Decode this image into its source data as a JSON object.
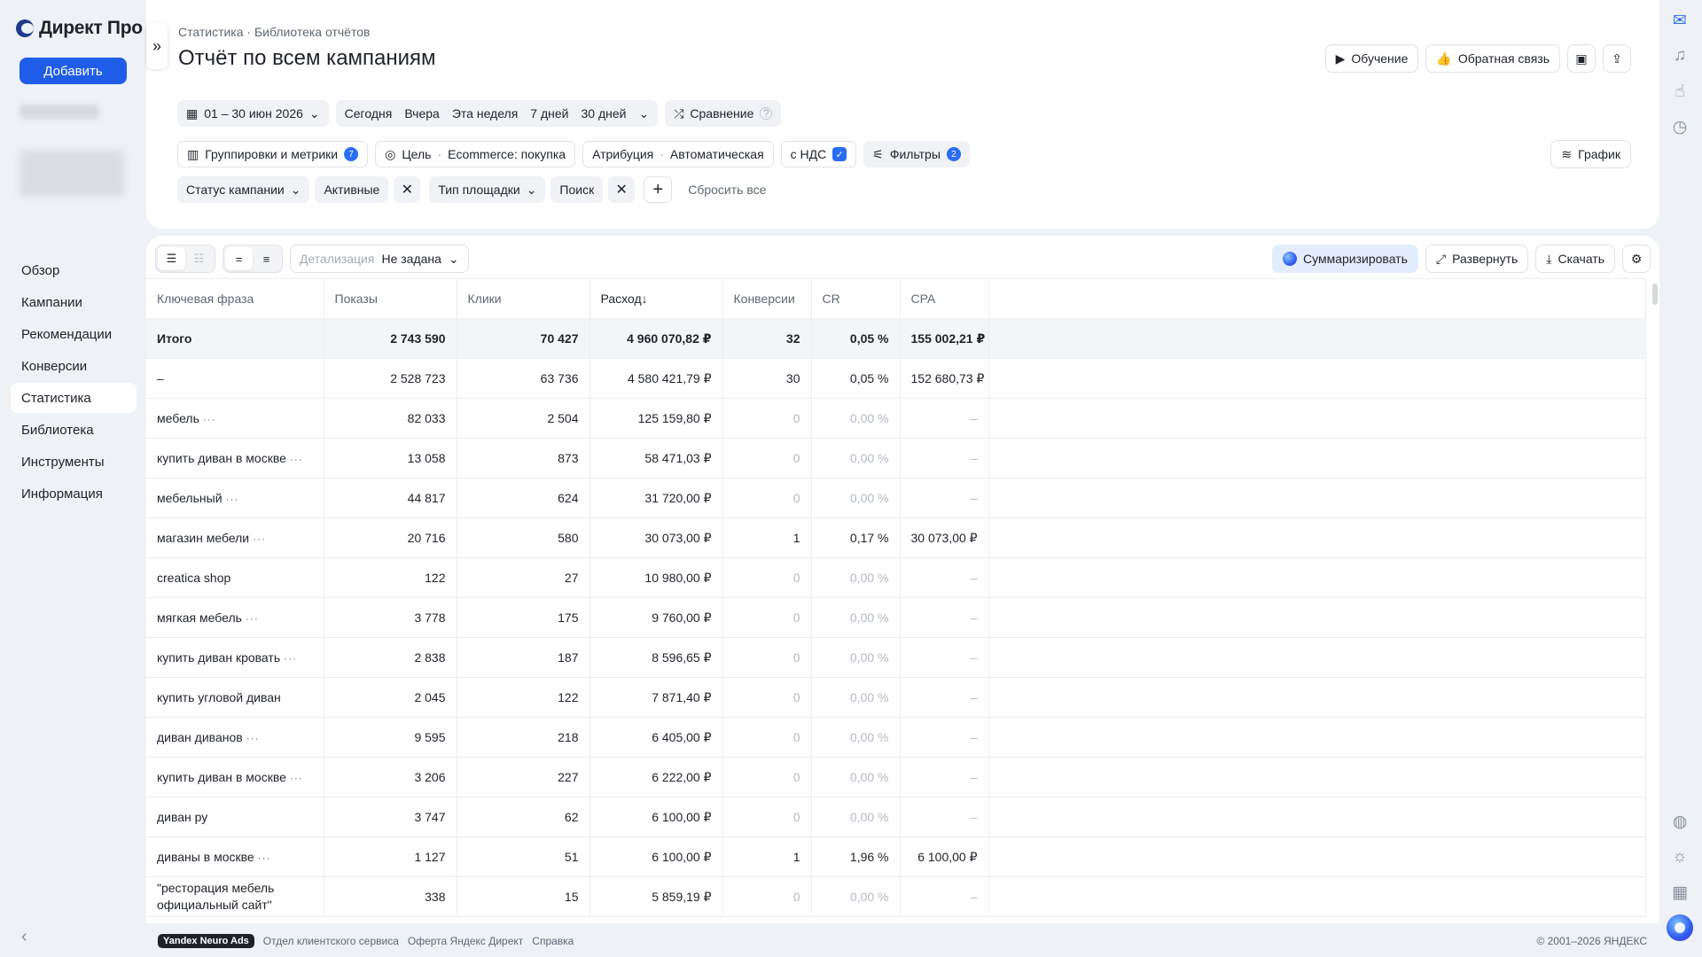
{
  "app": {
    "logo_text": "Директ Про",
    "add_label": "Добавить"
  },
  "nav": [
    "Обзор",
    "Кампании",
    "Рекомендации",
    "Конверсии",
    "Статистика",
    "Библиотека",
    "Инструменты",
    "Информация"
  ],
  "header": {
    "breadcrumb": "Статистика · Библиотека отчётов",
    "title": "Отчёт по всем кампаниям",
    "learn_label": "Обучение",
    "feedback_label": "Обратная связь"
  },
  "period": {
    "range": "01 – 30 июн 2026",
    "presets": [
      "Сегодня",
      "Вчера",
      "Эта неделя",
      "7 дней",
      "30 дней"
    ],
    "compare_label": "Сравнение"
  },
  "settings": {
    "groupings_label": "Группировки и метрики",
    "groupings_count": "7",
    "goal_label": "Цель",
    "goal_value": "Ecommerce: покупка",
    "attribution_label": "Атрибуция",
    "attribution_value": "Автоматическая",
    "vat_label": "с НДС",
    "filters_label": "Фильтры",
    "filters_count": "2",
    "graph_label": "График"
  },
  "filters": {
    "campaign_status_label": "Статус кампании",
    "campaign_status_value": "Активные",
    "placement_type_label": "Тип площадки",
    "placement_type_value": "Поиск",
    "reset_label": "Сбросить все"
  },
  "toolbar": {
    "detail_label": "Детализация",
    "detail_value": "Не задана",
    "summarize_label": "Суммаризировать",
    "expand_label": "Развернуть",
    "download_label": "Скачать"
  },
  "table": {
    "columns": [
      "Ключевая фраза",
      "Показы",
      "Клики",
      "Расход",
      "Конверсии",
      "CR",
      "CPA"
    ],
    "sort_indicator": "↓",
    "rows": [
      {
        "phrase": "Итого",
        "shows": "2 743 590",
        "clicks": "70 427",
        "cost": "4 960 070,82 ₽",
        "conv": "32",
        "cr": "0,05 %",
        "cpa": "155 002,21 ₽"
      },
      {
        "phrase": "–",
        "shows": "2 528 723",
        "clicks": "63 736",
        "cost": "4 580 421,79 ₽",
        "conv": "30",
        "cr": "0,05 %",
        "cpa": "152 680,73 ₽"
      },
      {
        "phrase": "мебель",
        "dots": true,
        "shows": "82 033",
        "clicks": "2 504",
        "cost": "125 159,80 ₽",
        "conv": "0",
        "cr": "0,00 %",
        "cpa": "–"
      },
      {
        "phrase": "купить диван в москве",
        "dots": true,
        "shows": "13 058",
        "clicks": "873",
        "cost": "58 471,03 ₽",
        "conv": "0",
        "cr": "0,00 %",
        "cpa": "–"
      },
      {
        "phrase": "мебельный",
        "dots": true,
        "shows": "44 817",
        "clicks": "624",
        "cost": "31 720,00 ₽",
        "conv": "0",
        "cr": "0,00 %",
        "cpa": "–"
      },
      {
        "phrase": "магазин мебели",
        "dots": true,
        "shows": "20 716",
        "clicks": "580",
        "cost": "30 073,00 ₽",
        "conv": "1",
        "cr": "0,17 %",
        "cpa": "30 073,00 ₽"
      },
      {
        "phrase": "creatica shop",
        "shows": "122",
        "clicks": "27",
        "cost": "10 980,00 ₽",
        "conv": "0",
        "cr": "0,00 %",
        "cpa": "–"
      },
      {
        "phrase": "мягкая мебель",
        "dots": true,
        "shows": "3 778",
        "clicks": "175",
        "cost": "9 760,00 ₽",
        "conv": "0",
        "cr": "0,00 %",
        "cpa": "–"
      },
      {
        "phrase": "купить диван кровать",
        "dots": true,
        "shows": "2 838",
        "clicks": "187",
        "cost": "8 596,65 ₽",
        "conv": "0",
        "cr": "0,00 %",
        "cpa": "–"
      },
      {
        "phrase": "купить угловой диван",
        "shows": "2 045",
        "clicks": "122",
        "cost": "7 871,40 ₽",
        "conv": "0",
        "cr": "0,00 %",
        "cpa": "–"
      },
      {
        "phrase": "диван диванов",
        "dots": true,
        "shows": "9 595",
        "clicks": "218",
        "cost": "6 405,00 ₽",
        "conv": "0",
        "cr": "0,00 %",
        "cpa": "–"
      },
      {
        "phrase": "купить диван в москве",
        "dots": true,
        "shows": "3 206",
        "clicks": "227",
        "cost": "6 222,00 ₽",
        "conv": "0",
        "cr": "0,00 %",
        "cpa": "–"
      },
      {
        "phrase": "диван ру",
        "shows": "3 747",
        "clicks": "62",
        "cost": "6 100,00 ₽",
        "conv": "0",
        "cr": "0,00 %",
        "cpa": "–"
      },
      {
        "phrase": "диваны в москве",
        "dots": true,
        "shows": "1 127",
        "clicks": "51",
        "cost": "6 100,00 ₽",
        "conv": "1",
        "cr": "1,96 %",
        "cpa": "6 100,00 ₽"
      },
      {
        "phrase": "\"ресторация мебель официальный сайт\"",
        "wrap": true,
        "shows": "338",
        "clicks": "15",
        "cost": "5 859,19 ₽",
        "conv": "0",
        "cr": "0,00 %",
        "cpa": "–"
      }
    ]
  },
  "footer": {
    "neuro_label": "Yandex Neuro Ads",
    "links": [
      "Отдел клиентского сервиса",
      "Оферта Яндекс Директ",
      "Справка"
    ],
    "copyright": "© 2001–2026 ЯНДЕКС"
  }
}
